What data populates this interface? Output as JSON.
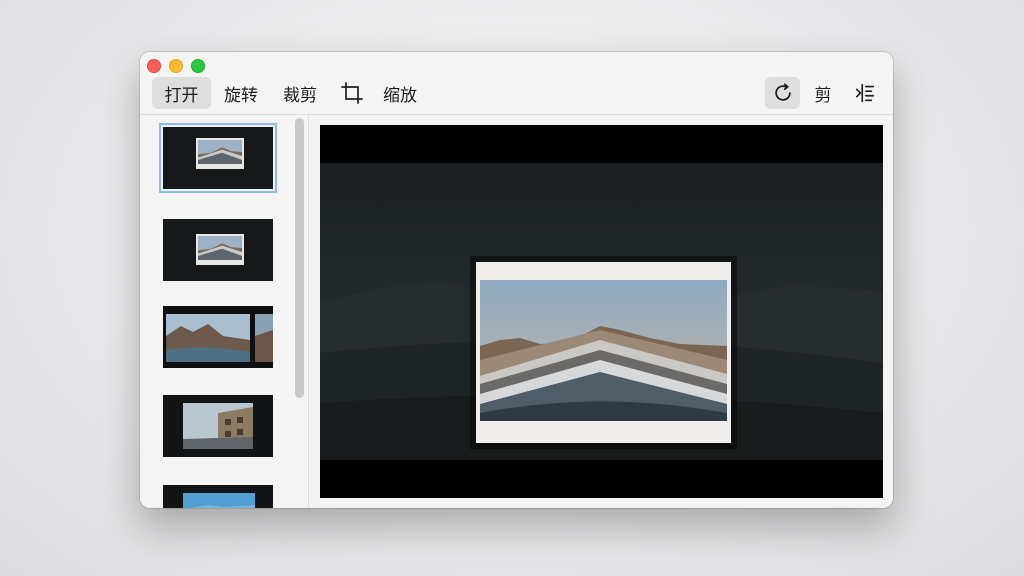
{
  "toolbar": {
    "open_label": "打开",
    "rotate_label": "旋转",
    "crop_label": "裁剪",
    "zoom_label": "缩放",
    "cut_label": "剪"
  },
  "icons": {
    "crop": "crop-icon",
    "refresh": "rotate-refresh-icon",
    "align": "align-list-icon"
  },
  "sidebar": {
    "thumbnails": [
      {
        "subject": "mountain-ridge",
        "selected": true
      },
      {
        "subject": "mountain-ridge",
        "selected": false
      },
      {
        "subject": "canyon-river",
        "selected": false
      },
      {
        "subject": "street-building",
        "selected": false
      },
      {
        "subject": "sky-landscape",
        "selected": false
      }
    ]
  },
  "colors": {
    "selection_outline": "#8db8f0",
    "traffic_red": "#ff5f57",
    "traffic_yellow": "#febc2e",
    "traffic_green": "#28c840"
  }
}
